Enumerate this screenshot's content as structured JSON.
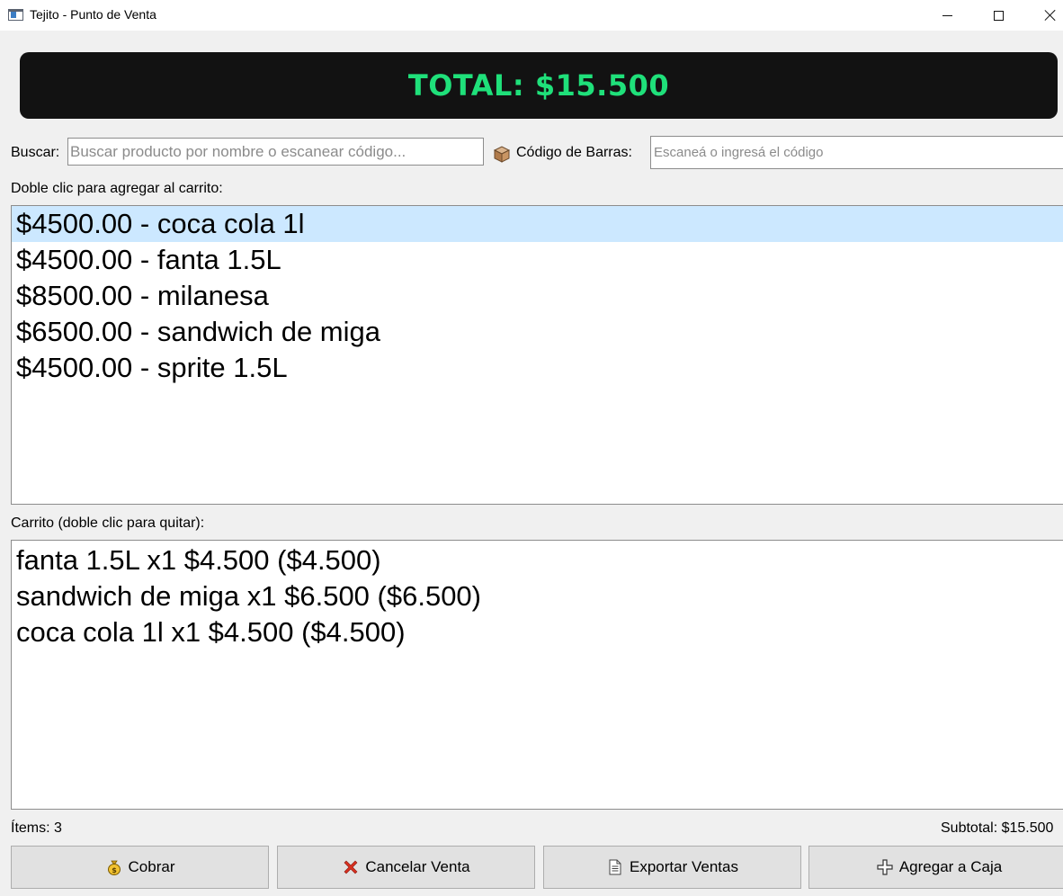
{
  "window": {
    "title": "Tejito - Punto de Venta"
  },
  "total": {
    "text": "TOTAL: $15.500",
    "color": "#1fe07a",
    "background": "#121212"
  },
  "search": {
    "label": "Buscar:",
    "placeholder": "Buscar producto por nombre o escanear código...",
    "value": ""
  },
  "barcode": {
    "icon": "box-icon",
    "label": "Código de Barras:",
    "placeholder": "Escaneá o ingresá el código",
    "value": ""
  },
  "products": {
    "hint": "Doble clic para agregar al carrito:",
    "items": [
      {
        "label": "$4500.00 - coca cola 1l",
        "selected": true
      },
      {
        "label": "$4500.00 - fanta 1.5L",
        "selected": false
      },
      {
        "label": "$8500.00 - milanesa",
        "selected": false
      },
      {
        "label": "$6500.00 - sandwich de miga",
        "selected": false
      },
      {
        "label": "$4500.00 - sprite 1.5L",
        "selected": false
      }
    ]
  },
  "cart": {
    "hint": "Carrito (doble clic para quitar):",
    "items": [
      {
        "label": "fanta 1.5L x1 $4.500 ($4.500)"
      },
      {
        "label": "sandwich de miga x1 $6.500 ($6.500)"
      },
      {
        "label": "coca cola 1l x1 $4.500 ($4.500)"
      }
    ]
  },
  "footer": {
    "items_count": "Ítems: 3",
    "subtotal": "Subtotal: $15.500"
  },
  "buttons": [
    {
      "label": "Cobrar",
      "icon": "money-bag-icon"
    },
    {
      "label": "Cancelar Venta",
      "icon": "cross-mark-icon"
    },
    {
      "label": "Exportar Ventas",
      "icon": "document-icon"
    },
    {
      "label": "Agregar a Caja",
      "icon": "plus-icon"
    }
  ],
  "colors": {
    "selection": "#cce8ff",
    "window_bg": "#f0f0f0"
  }
}
